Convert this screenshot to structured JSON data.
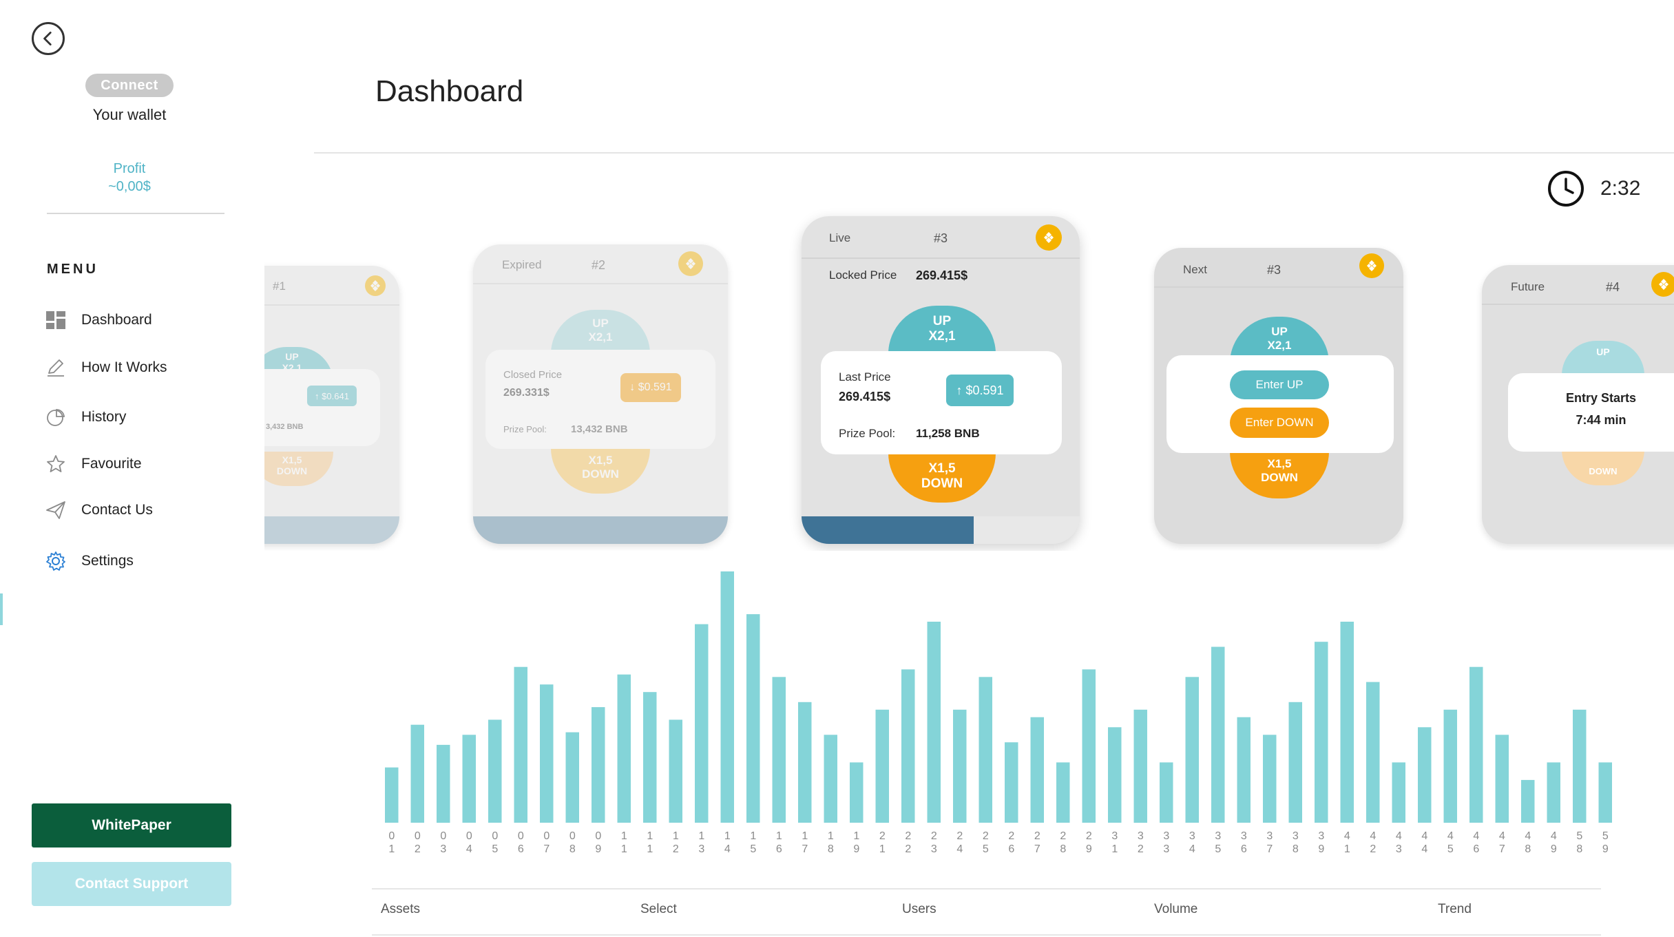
{
  "sidebar": {
    "connect_label": "Connect",
    "wallet_label": "Your wallet",
    "profit_label": "Profit",
    "profit_value": "~0,00$",
    "menu_heading": "MENU",
    "items": [
      {
        "label": "Dashboard",
        "icon": "grid-icon"
      },
      {
        "label": "How It Works",
        "icon": "pencil-icon"
      },
      {
        "label": "History",
        "icon": "pie-chart-icon"
      },
      {
        "label": "Favourite",
        "icon": "star-icon"
      },
      {
        "label": "Contact Us",
        "icon": "send-icon"
      },
      {
        "label": "Settings",
        "icon": "gear-icon"
      }
    ],
    "whitepaper_label": "WhitePaper",
    "support_label": "Contact Support"
  },
  "header": {
    "title": "Dashboard",
    "timer": "2:32"
  },
  "cards": {
    "c1": {
      "num": "#1",
      "up": "UP",
      "up_mult": "X2,1",
      "price_change": "$0.641",
      "pool": "3,432 BNB",
      "down_mult": "X1,5",
      "down": "DOWN"
    },
    "c2": {
      "status": "Expired",
      "num": "#2",
      "up": "UP",
      "up_mult": "X2,1",
      "closed_label": "Closed Price",
      "closed_value": "269.331$",
      "price_change": "$0.591",
      "pool_label": "Prize Pool:",
      "pool_value": "13,432 BNB",
      "down_mult": "X1,5",
      "down": "DOWN"
    },
    "c3": {
      "status": "Live",
      "num": "#3",
      "locked_label": "Locked Price",
      "locked_value": "269.415$",
      "up": "UP",
      "up_mult": "X2,1",
      "last_label": "Last Price",
      "last_value": "269.415$",
      "price_change": "$0.591",
      "pool_label": "Prize Pool:",
      "pool_value": "11,258 BNB",
      "down_mult": "X1,5",
      "down": "DOWN",
      "progress": 0.62
    },
    "c4": {
      "status": "Next",
      "num": "#3",
      "up": "UP",
      "up_mult": "X2,1",
      "enter_up": "Enter UP",
      "enter_down": "Enter DOWN",
      "down_mult": "X1,5",
      "down": "DOWN"
    },
    "c5": {
      "status": "Future",
      "num": "#4",
      "up": "UP",
      "entry_label": "Entry Starts",
      "entry_time": "7:44 min",
      "down": "DOWN"
    }
  },
  "colors": {
    "accent": "#5bbcc5",
    "down": "#f6a010",
    "bnb": "#f5b300",
    "whitepaper": "#0b5e3c",
    "bar": "#84d4d8"
  },
  "chart_data": {
    "type": "bar",
    "categories": [
      "01",
      "02",
      "03",
      "04",
      "05",
      "06",
      "07",
      "08",
      "09",
      "11",
      "11",
      "12",
      "13",
      "14",
      "15",
      "16",
      "17",
      "18",
      "19",
      "21",
      "22",
      "23",
      "24",
      "25",
      "26",
      "27",
      "28",
      "29",
      "31",
      "32",
      "33",
      "34",
      "35",
      "36",
      "37",
      "38",
      "39",
      "41",
      "42",
      "43",
      "44",
      "45",
      "46",
      "47",
      "48",
      "49",
      "58",
      "59"
    ],
    "values": [
      22,
      39,
      31,
      35,
      41,
      62,
      55,
      36,
      46,
      59,
      52,
      41,
      79,
      100,
      83,
      58,
      48,
      35,
      24,
      45,
      61,
      80,
      45,
      58,
      32,
      42,
      24,
      61,
      38,
      45,
      24,
      58,
      70,
      42,
      35,
      48,
      72,
      80,
      56,
      24,
      38,
      45,
      62,
      35,
      17,
      24,
      45,
      24
    ],
    "ylim": [
      0,
      100
    ],
    "footer_columns": [
      "Assets",
      "Select",
      "Users",
      "Volume",
      "Trend"
    ]
  }
}
